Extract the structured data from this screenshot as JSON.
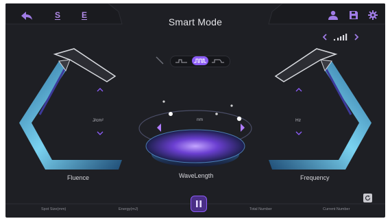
{
  "header": {
    "title": "Smart Mode",
    "s_label": "S",
    "e_label": "E",
    "icons": [
      "back-arrow-icon",
      "user-icon",
      "save-icon",
      "settings-gear-icon"
    ]
  },
  "signal": {
    "icon": "signal-bars-icon",
    "prev_icon": "chevron-left-icon",
    "next_icon": "chevron-right-icon"
  },
  "pulse_modes": {
    "items": [
      "pulse-mode-1",
      "pulse-mode-2",
      "pulse-mode-3"
    ],
    "selected_index": 1
  },
  "fluence": {
    "label": "Fluence",
    "unit": "J/cm²"
  },
  "wavelength": {
    "label": "WaveLength",
    "unit": "nm"
  },
  "frequency": {
    "label": "Frequency",
    "unit": "Hz"
  },
  "footer": {
    "spot_size_label": "Spot Size(mm)",
    "energy_label": "Energy(mJ)",
    "total_number_label": "Total Number",
    "current_number_label": "Current Number",
    "pause_icon": "pause-icon",
    "reset_icon": "reset-icon"
  },
  "colors": {
    "accent": "#8b5cf6",
    "highlight": "#b28be8",
    "handpiece": "#6fd3f4",
    "background": "#1e1f24"
  }
}
